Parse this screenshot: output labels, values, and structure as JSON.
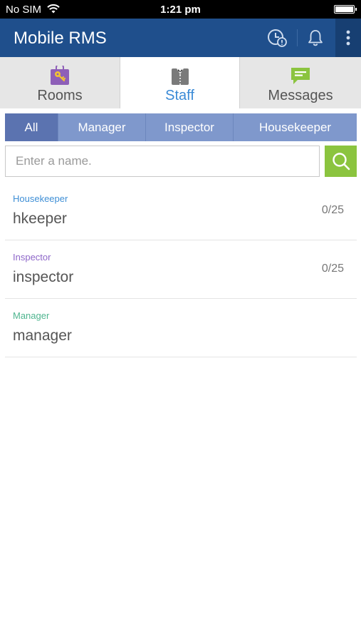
{
  "status_bar": {
    "carrier": "No SIM",
    "time": "1:21 pm"
  },
  "header": {
    "title": "Mobile RMS",
    "color": "#1f4f8c"
  },
  "main_tabs": [
    {
      "label": "Rooms",
      "icon": "rooms-key-icon",
      "active": false
    },
    {
      "label": "Staff",
      "icon": "staff-uniform-icon",
      "active": true
    },
    {
      "label": "Messages",
      "icon": "messages-chat-icon",
      "active": false
    }
  ],
  "filter_tabs": [
    {
      "label": "All",
      "active": true
    },
    {
      "label": "Manager",
      "active": false
    },
    {
      "label": "Inspector",
      "active": false
    },
    {
      "label": "Housekeeper",
      "active": false
    }
  ],
  "search": {
    "placeholder": "Enter a name.",
    "value": "",
    "button_color": "#8bc43f"
  },
  "staff": [
    {
      "role": "Housekeeper",
      "name": "hkeeper",
      "count": "0/25",
      "role_color": "#3f8fd6"
    },
    {
      "role": "Inspector",
      "name": "inspector",
      "count": "0/25",
      "role_color": "#8e67c9"
    },
    {
      "role": "Manager",
      "name": "manager",
      "count": "",
      "role_color": "#4fb58f"
    }
  ]
}
